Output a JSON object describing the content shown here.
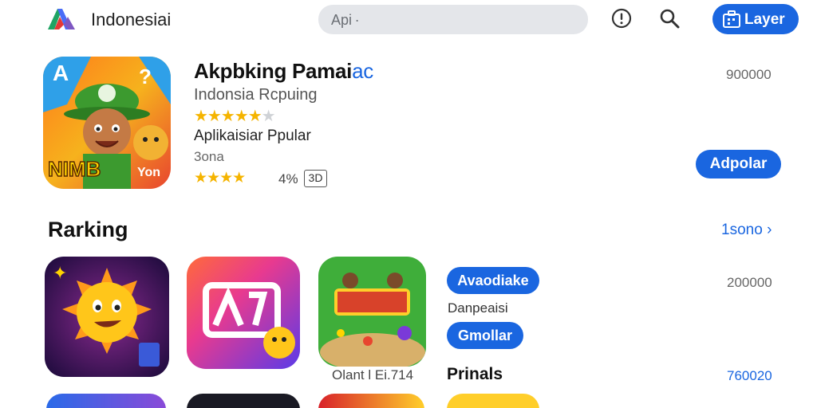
{
  "header": {
    "brand": "Indonesiai",
    "search_value": "Api ·",
    "info_icon": "info-icon",
    "search_icon": "search-icon",
    "layer_label": "Layer",
    "layer_icon": "briefcase-icon"
  },
  "featured": {
    "title_main": "Akpbking Pamai",
    "title_accent": "ac",
    "subtitle": "Indonsia Rcpuing",
    "rating_stars": "★★★★★",
    "rating_off": "★",
    "category": "Aplikaisiar Ppular",
    "size": "3ona",
    "stars_small": "★★★★",
    "percent": "4%",
    "age": "3D",
    "count": "900000",
    "install_label": "Adpolar",
    "icon_art_text": "NIMB",
    "icon_badge": "Yon"
  },
  "ranking": {
    "title": "Rarking",
    "see_all": "1sono",
    "see_all_icon": "chevron-right-icon",
    "pill_1": "Avaodiake",
    "label": "Danpeaisi",
    "pill_2": "Gmollar",
    "count": "200000",
    "caption": "Olant l Ei.714",
    "name": "Prinals",
    "count_2": "760020"
  },
  "colors": {
    "accent": "#1a66e0",
    "star": "#f5b400",
    "search_bg": "#e4e6ea"
  }
}
